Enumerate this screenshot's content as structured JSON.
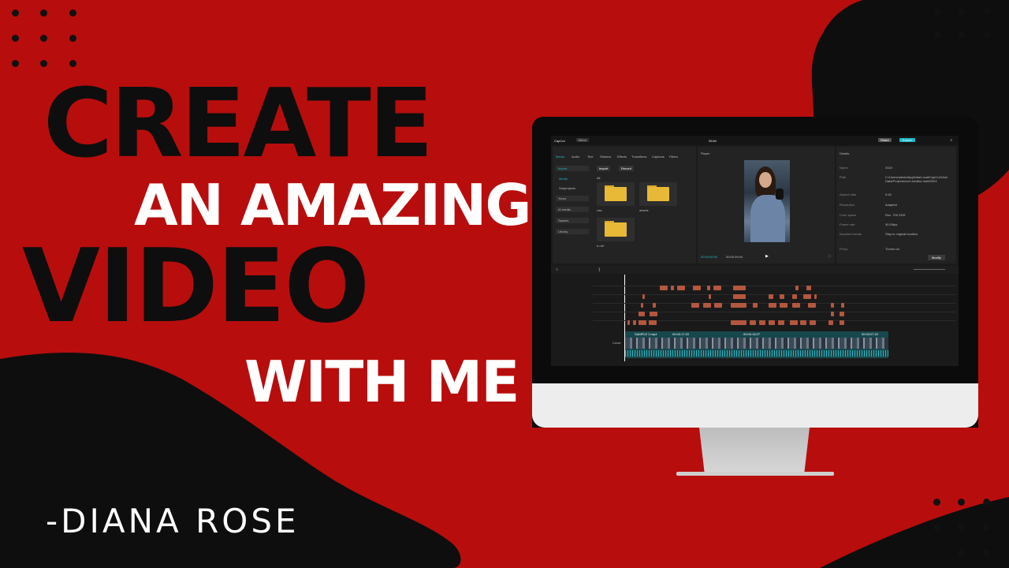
{
  "headline": {
    "line1": "CREATE",
    "line2": "AN AMAZING",
    "line3": "VIDEO",
    "line4": "WITH ME"
  },
  "author": "-DIANA ROSE",
  "colors": {
    "background": "#b80d0d",
    "dark": "#0e0e0e",
    "accent": "#1fb8c7",
    "clip": "#b4573f"
  },
  "editor": {
    "app_name": "CapCut",
    "menu_label": "Menu",
    "project_time": "05:84",
    "share_label": "Share",
    "export_label": "Export",
    "tabs": [
      "Media",
      "Audio",
      "Text",
      "Stickers",
      "Effects",
      "Transitions",
      "Captions",
      "Filters"
    ],
    "sidebar": [
      "Import",
      "Media",
      "Subprojects",
      "Yours",
      "AI media",
      "Spaces",
      "Library"
    ],
    "import_button": "Import",
    "record_button": "Record",
    "all_label": "All",
    "folders": [
      "raw",
      "assets",
      "b-roll"
    ],
    "player_title": "Player",
    "current_time": "00:00:00:00",
    "total_time": "00:00:39:04",
    "details_title": "Details",
    "details": [
      {
        "k": "Name",
        "v": "0324"
      },
      {
        "k": "Path",
        "v": "C:/Users/admin/AppData/Local/CapCut/User Data/Projects/com.lveditor.draft/0324"
      },
      {
        "k": "Aspect ratio",
        "v": "9:16"
      },
      {
        "k": "Resolution",
        "v": "Adapted"
      },
      {
        "k": "Color space",
        "v": "Rec. 709 SDR"
      },
      {
        "k": "Frame rate",
        "v": "30.00fps"
      },
      {
        "k": "Imported media",
        "v": "Stay in original location"
      },
      {
        "k": "Proxy",
        "v": "Turned on"
      }
    ],
    "modify_label": "Modify",
    "main_track_clip": "SAMPLE 2.mp4",
    "cover_label": "Cover",
    "main_clip_times": [
      "00:00:17:22",
      "00:00:18:27",
      "00:00:07:22"
    ]
  }
}
